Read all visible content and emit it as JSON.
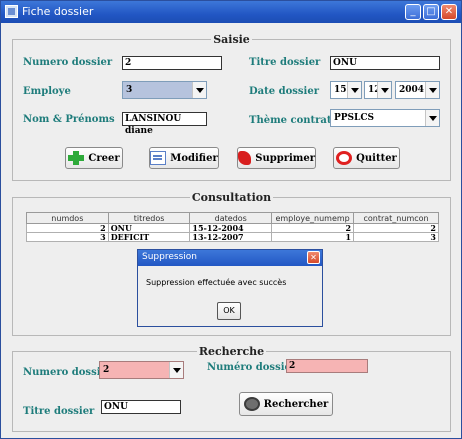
{
  "window": {
    "title": "Fiche dossier",
    "min": "_",
    "max": "□",
    "close": "✕"
  },
  "saisie": {
    "legend": "Saisie",
    "numero_label": "Numero      dossier",
    "numero_value": "2",
    "titre_label": "Titre dossier",
    "titre_value": "ONU",
    "employe_label": "Employe",
    "employe_value": "3",
    "date_label": "Date dossier",
    "date_day": "15",
    "date_month": "12",
    "date_year": "2004",
    "nom_label": "Nom & Prénoms",
    "nom_value": "LANSINOU diane",
    "theme_label": "Thème contrat",
    "theme_value": "PPSLCS"
  },
  "buttons": {
    "creer": "Creer",
    "modifier": "Modifier",
    "supprimer": "Supprimer",
    "quitter": "Quitter",
    "rechercher": "Rechercher"
  },
  "consultation": {
    "legend": "Consultation",
    "columns": [
      "numdos",
      "titredos",
      "datedos",
      "employe_numemp",
      "contrat_numcon"
    ],
    "rows": [
      [
        "2",
        "ONU",
        "15-12-2004",
        "2",
        "2"
      ],
      [
        "3",
        "DEFICIT",
        "13-12-2007",
        "1",
        "3"
      ]
    ]
  },
  "dialog": {
    "title": "Suppression",
    "message": "Suppression effectuée avec succès",
    "ok": "OK",
    "close": "✕"
  },
  "recherche": {
    "legend": "Recherche",
    "numero_label": "Numero    dossier",
    "numero_value": "2",
    "numero2_label": "Numéro   dossier",
    "numero2_value": "2",
    "titre_label": "Titre dossier",
    "titre_value": "ONU"
  },
  "colors": {
    "label": "#1e7c7b",
    "titlebar": "#2257c4",
    "highlight": "#f6b4b4"
  }
}
